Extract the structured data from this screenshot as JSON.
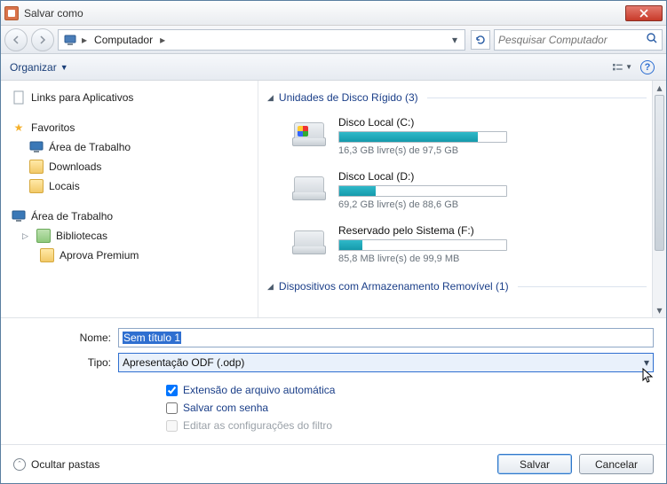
{
  "title": "Salvar como",
  "breadcrumb": {
    "root_icon": "computer",
    "item": "Computador"
  },
  "search": {
    "placeholder": "Pesquisar Computador"
  },
  "toolbar": {
    "organize": "Organizar"
  },
  "sidebar": {
    "links_apps": "Links para Aplicativos",
    "favorites": "Favoritos",
    "fav_items": {
      "desktop": "Área de Trabalho",
      "downloads": "Downloads",
      "locais": "Locais"
    },
    "desktop_section": "Área de Trabalho",
    "libraries": "Bibliotecas",
    "aprova": "Aprova Premium"
  },
  "main": {
    "group_hdd": "Unidades de Disco Rígido (3)",
    "drives": [
      {
        "name": "Disco Local (C:)",
        "free_text": "16,3 GB livre(s) de 97,5 GB",
        "fill_pct": 83,
        "win": true
      },
      {
        "name": "Disco Local (D:)",
        "free_text": "69,2 GB livre(s) de 88,6 GB",
        "fill_pct": 22,
        "win": false
      },
      {
        "name": "Reservado pelo Sistema (F:)",
        "free_text": "85,8 MB livre(s) de 99,9 MB",
        "fill_pct": 14,
        "win": false
      }
    ],
    "group_removable": "Dispositivos com Armazenamento Removível (1)"
  },
  "form": {
    "name_label": "Nome:",
    "name_value": "Sem título 1",
    "type_label": "Tipo:",
    "type_value": "Apresentação ODF (.odp)",
    "chk_autoext": "Extensão de arquivo automática",
    "chk_password": "Salvar com senha",
    "chk_filter": "Editar as configurações do filtro"
  },
  "footer": {
    "hide_folders": "Ocultar pastas",
    "save": "Salvar",
    "cancel": "Cancelar"
  }
}
